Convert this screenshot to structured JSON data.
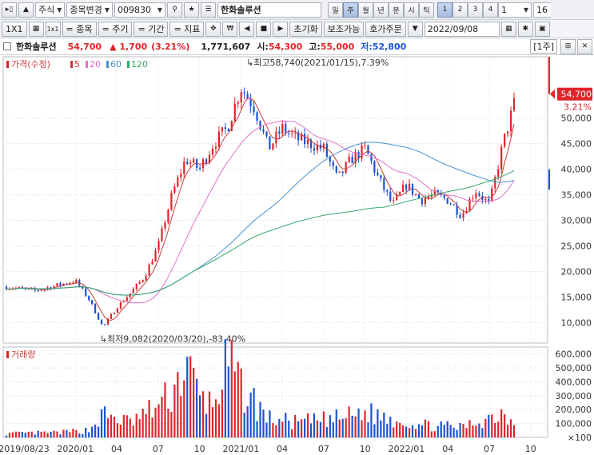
{
  "toolbar": {
    "market": "주식",
    "change_label": "종목변경",
    "code": "009830",
    "search_icon": "search-icon",
    "star_icon": "star-icon",
    "name_field": "한화솔루션",
    "periods": [
      "일",
      "주",
      "월",
      "년",
      "분",
      "시",
      "틱"
    ],
    "active_period": "주",
    "numbers": [
      "1",
      "2",
      "3",
      "4"
    ],
    "count_value": "1",
    "right_value": "16"
  },
  "toolbar2": {
    "layout": "1X1",
    "grid_label": "1x1",
    "item_btn": "= 종목",
    "cycle_btn": "= 주기",
    "range_btn": "= 기간",
    "indicator_btn": "= 지표",
    "won_symbol": "₩",
    "reset_btn": "초기화",
    "aux_btn": "보조가능",
    "order_btn": "호가주문",
    "date": "2022/09/08"
  },
  "info": {
    "name": "한화솔루션",
    "price": "54,700",
    "change": "▲ 1,700",
    "change_pct": "(3.21%)",
    "volume": "1,771,607",
    "open_label": "시:",
    "open": "54,300",
    "high_label": "고:",
    "high": "55,000",
    "low_label": "저:",
    "low": "52,800",
    "period_tag": "[1주]"
  },
  "chart_data": [
    {
      "type": "candlestick",
      "title": "가격(수정)",
      "legend": [
        "5",
        "20",
        "60",
        "120"
      ],
      "legend_colors": [
        "#c83c3c",
        "#e070c8",
        "#4a90d0",
        "#35a86a"
      ],
      "up_color": "#e0242b",
      "down_color": "#1a53d1",
      "ylim": [
        6000,
        62000
      ],
      "y_ticks": [
        10000,
        15000,
        20000,
        25000,
        30000,
        35000,
        40000,
        45000,
        50000
      ],
      "x_ticks": [
        "2019/08/23",
        "2020/01",
        "04",
        "07",
        "10",
        "2021/01",
        "04",
        "07",
        "10",
        "2022/01",
        "04",
        "07",
        "10"
      ],
      "current_price_label": "54,700",
      "current_pct_label": "3.21%",
      "current_price": 54700,
      "high_annotation": "최고58,740(2021/01/15),7.39%",
      "low_annotation": "최저9,082(2020/03/20),-83.40%",
      "close_points": [
        [
          "2019/08",
          17000
        ],
        [
          "2019/10",
          16200
        ],
        [
          "2019/12",
          17500
        ],
        [
          "2020/01",
          18200
        ],
        [
          "2020/02",
          14500
        ],
        [
          "2020/03",
          9082
        ],
        [
          "2020/04",
          13000
        ],
        [
          "2020/05",
          15800
        ],
        [
          "2020/06",
          19000
        ],
        [
          "2020/07",
          25000
        ],
        [
          "2020/08",
          35000
        ],
        [
          "2020/09",
          42000
        ],
        [
          "2020/10",
          40000
        ],
        [
          "2020/11",
          45000
        ],
        [
          "2020/12",
          48000
        ],
        [
          "2021/01",
          56000
        ],
        [
          "2021/02",
          52000
        ],
        [
          "2021/03",
          44000
        ],
        [
          "2021/04",
          48000
        ],
        [
          "2021/05",
          46000
        ],
        [
          "2021/06",
          45000
        ],
        [
          "2021/07",
          44000
        ],
        [
          "2021/08",
          38000
        ],
        [
          "2021/09",
          42000
        ],
        [
          "2021/10",
          44000
        ],
        [
          "2021/11",
          38000
        ],
        [
          "2021/12",
          33000
        ],
        [
          "2022/01",
          37000
        ],
        [
          "2022/02",
          34000
        ],
        [
          "2022/03",
          35000
        ],
        [
          "2022/04",
          34000
        ],
        [
          "2022/05",
          31000
        ],
        [
          "2022/06",
          36000
        ],
        [
          "2022/07",
          33000
        ],
        [
          "2022/08",
          45000
        ],
        [
          "2022/09",
          54700
        ]
      ]
    },
    {
      "type": "bar",
      "title": "거래량",
      "y_ticks": [
        100,
        100000,
        200000,
        300000,
        400000,
        500000,
        600000
      ],
      "y_tick_labels": [
        "×100",
        "100,000",
        "200,000",
        "300,000",
        "400,000",
        "500,000",
        "600,000"
      ],
      "ylim": [
        0,
        650000
      ],
      "values_sampled": [
        [
          "2019/08",
          30000
        ],
        [
          "2019/12",
          40000
        ],
        [
          "2020/02",
          60000
        ],
        [
          "2020/03",
          180000
        ],
        [
          "2020/05",
          120000
        ],
        [
          "2020/07",
          250000
        ],
        [
          "2020/08",
          350000
        ],
        [
          "2020/09",
          580000
        ],
        [
          "2020/10",
          320000
        ],
        [
          "2020/11",
          260000
        ],
        [
          "2020/12",
          580000
        ],
        [
          "2021/01",
          400000
        ],
        [
          "2021/03",
          150000
        ],
        [
          "2021/05",
          120000
        ],
        [
          "2021/08",
          150000
        ],
        [
          "2021/10",
          200000
        ],
        [
          "2021/12",
          150000
        ],
        [
          "2022/02",
          100000
        ],
        [
          "2022/05",
          80000
        ],
        [
          "2022/08",
          200000
        ],
        [
          "2022/09",
          120000
        ]
      ]
    }
  ]
}
